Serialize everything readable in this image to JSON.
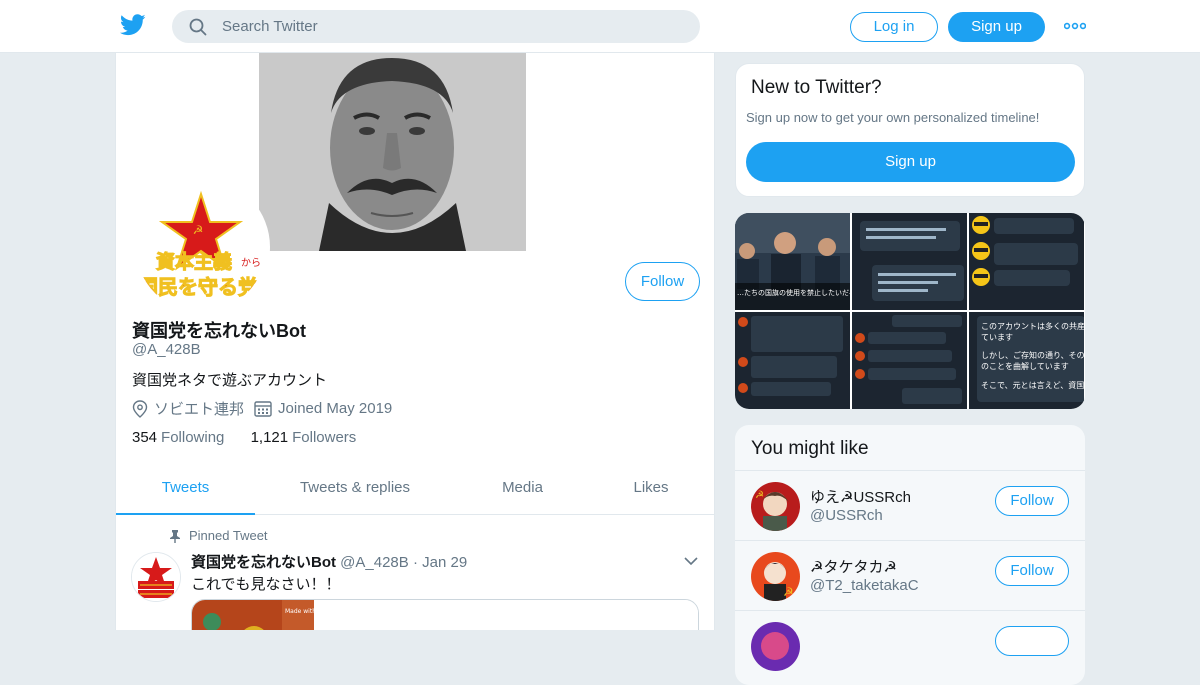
{
  "search": {
    "placeholder": "Search Twitter"
  },
  "header": {
    "login_label": "Log in",
    "signup_label": "Sign up"
  },
  "profile": {
    "name": "資国党を忘れないBot",
    "handle": "@A_428B",
    "bio": "資国党ネタで遊ぶアカウント",
    "location": "ソビエト連邦",
    "joined": "Joined May 2019",
    "following_count": "354",
    "following_label": "Following",
    "followers_count": "1,121",
    "followers_label": "Followers",
    "follow_label": "Follow",
    "avatar_text_line1": "資本主義",
    "avatar_text_small": "から",
    "avatar_text_line2": "国民を守る党"
  },
  "tabs": [
    {
      "label": "Tweets",
      "active": true
    },
    {
      "label": "Tweets & replies",
      "active": false
    },
    {
      "label": "Media",
      "active": false
    },
    {
      "label": "Likes",
      "active": false
    }
  ],
  "pinned_tweet": {
    "pinned_label": "Pinned Tweet",
    "author_name": "資国党を忘れないBot",
    "author_handle": "@A_428B",
    "separator": "·",
    "date": "Jan 29",
    "text": "これでも見なさい！！"
  },
  "new_to_twitter": {
    "title": "New to Twitter?",
    "subtitle": "Sign up now to get your own personalized timeline!",
    "signup_label": "Sign up"
  },
  "gallery": {
    "tile1_caption": "…たちの国旗の使用を禁止したいだろうけ さようならを言うために協力う",
    "tile6_lines": [
      "このアカウントは多くの共産",
      "ています",
      "しかし、ご存知の通り、その",
      "のことを曲解しています",
      "そこで、元とは言えど、資国"
    ]
  },
  "you_might_like": {
    "title": "You might like",
    "accounts": [
      {
        "name": "ゆえ☭USSRch",
        "handle": "@USSRch",
        "follow_label": "Follow"
      },
      {
        "name": "☭タケタカ☭",
        "handle": "@T2_taketakaC",
        "follow_label": "Follow"
      }
    ]
  },
  "colors": {
    "accent": "#1da1f2",
    "background": "#e6ecf0",
    "border": "#e1e8ed",
    "secondary_text": "#657786"
  }
}
